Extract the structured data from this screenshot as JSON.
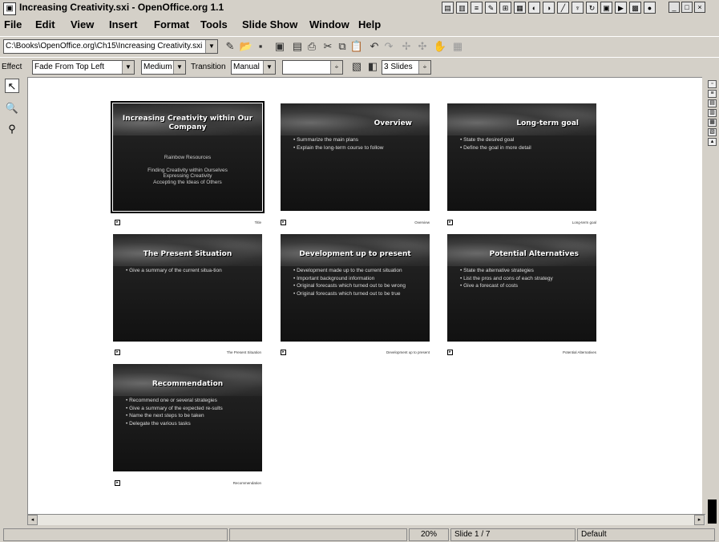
{
  "window": {
    "title": "Increasing Creativity.sxi - OpenOffice.org 1.1"
  },
  "menu": [
    "File",
    "Edit",
    "View",
    "Insert",
    "Format",
    "Tools",
    "Slide Show",
    "Window",
    "Help"
  ],
  "function_bar": {
    "file_path": "C:\\Books\\OpenOffice.org\\Ch15\\Increasing Creativity.sxi"
  },
  "slide_bar": {
    "effect_label": "Effect",
    "effect_value": "Fade From Top Left",
    "speed_value": "Medium",
    "transition_label": "Transition",
    "transition_value": "Manual",
    "time_value": "",
    "slides_per_row": "3 Slides"
  },
  "slides": [
    {
      "title": "Increasing Creativity within Our Company",
      "center_lines": [
        "Rainbow Resources",
        "",
        "Finding Creativity within Ourselves",
        "Expressing Creativity",
        "Accepting the Ideas of Others"
      ],
      "bullets": [],
      "name": "Title"
    },
    {
      "title": "Overview",
      "bullets": [
        "Summarize the main plans",
        "Explain the long-term course to follow"
      ],
      "name": "Overview"
    },
    {
      "title": "Long-term goal",
      "bullets": [
        "State the desired goal",
        "Define the goal in more detail"
      ],
      "name": "Long-term goal"
    },
    {
      "title": "The Present Situation",
      "bullets": [
        "Give a summary of the current situa-tion"
      ],
      "name": "The Present Situation"
    },
    {
      "title": "Development up to present",
      "bullets": [
        "Development made up to the current situation",
        "Important background information",
        "Original forecasts which turned out to be wrong",
        "Original forecasts which turned out to be true"
      ],
      "name": "Development up to present"
    },
    {
      "title": "Potential Alternatives",
      "bullets": [
        "State the alternative strategies",
        "List the pros and cons of each strategy",
        "Give a forecast of costs"
      ],
      "name": "Potential Alternatives"
    },
    {
      "title": "Recommendation",
      "bullets": [
        "Recommend one or several strategies",
        "Give a summary of the expected re-sults",
        "Name the next steps to be taken",
        "Delegate the various tasks"
      ],
      "name": "Recommendation"
    }
  ],
  "status": {
    "zoom": "20%",
    "slide": "Slide 1 / 7",
    "layout": "Default"
  }
}
